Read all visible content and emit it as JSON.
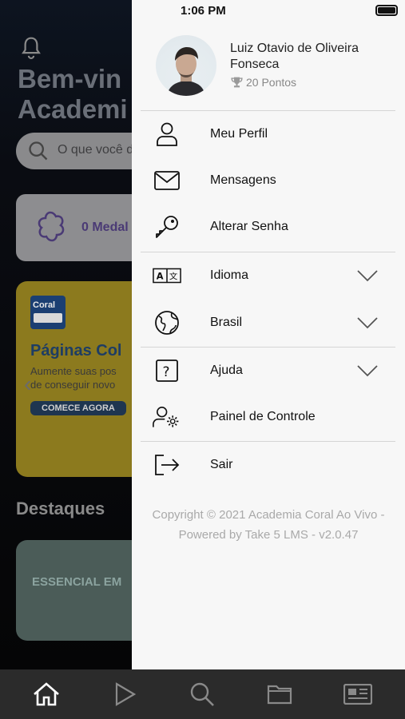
{
  "status_bar": {
    "time": "1:06 PM"
  },
  "background": {
    "title": "Bem-vin\nAcademi",
    "search_placeholder": "O que você d",
    "medals": "0 Medal",
    "banner": {
      "logo": "Coral",
      "title": "Páginas Col",
      "description": "Aumente suas pos\nde conseguir novo",
      "cta": "COMECE AGORA"
    },
    "section_title": "Destaques",
    "card_title": "ESSENCIAL EM"
  },
  "drawer": {
    "user": {
      "name": "Luiz Otavio de Oliveira Fonseca",
      "points": "20 Pontos"
    },
    "menu": [
      {
        "label": "Meu Perfil",
        "icon": "user-icon"
      },
      {
        "label": "Mensagens",
        "icon": "envelope-icon"
      },
      {
        "label": "Alterar Senha",
        "icon": "key-icon"
      },
      {
        "label": "Idioma",
        "icon": "translate-icon",
        "dropdown": true
      },
      {
        "label": "Brasil",
        "icon": "globe-icon",
        "dropdown": true
      },
      {
        "label": "Ajuda",
        "icon": "help-icon",
        "dropdown": true
      },
      {
        "label": "Painel de Controle",
        "icon": "user-settings-icon"
      },
      {
        "label": "Sair",
        "icon": "logout-icon"
      }
    ],
    "copyright": "Copyright © 2021 Academia Coral Ao Vivo - Powered by Take 5 LMS - v2.0.47"
  },
  "tabbar": {
    "tabs": [
      "home-icon",
      "play-icon",
      "search-icon",
      "folder-icon",
      "news-icon"
    ]
  }
}
